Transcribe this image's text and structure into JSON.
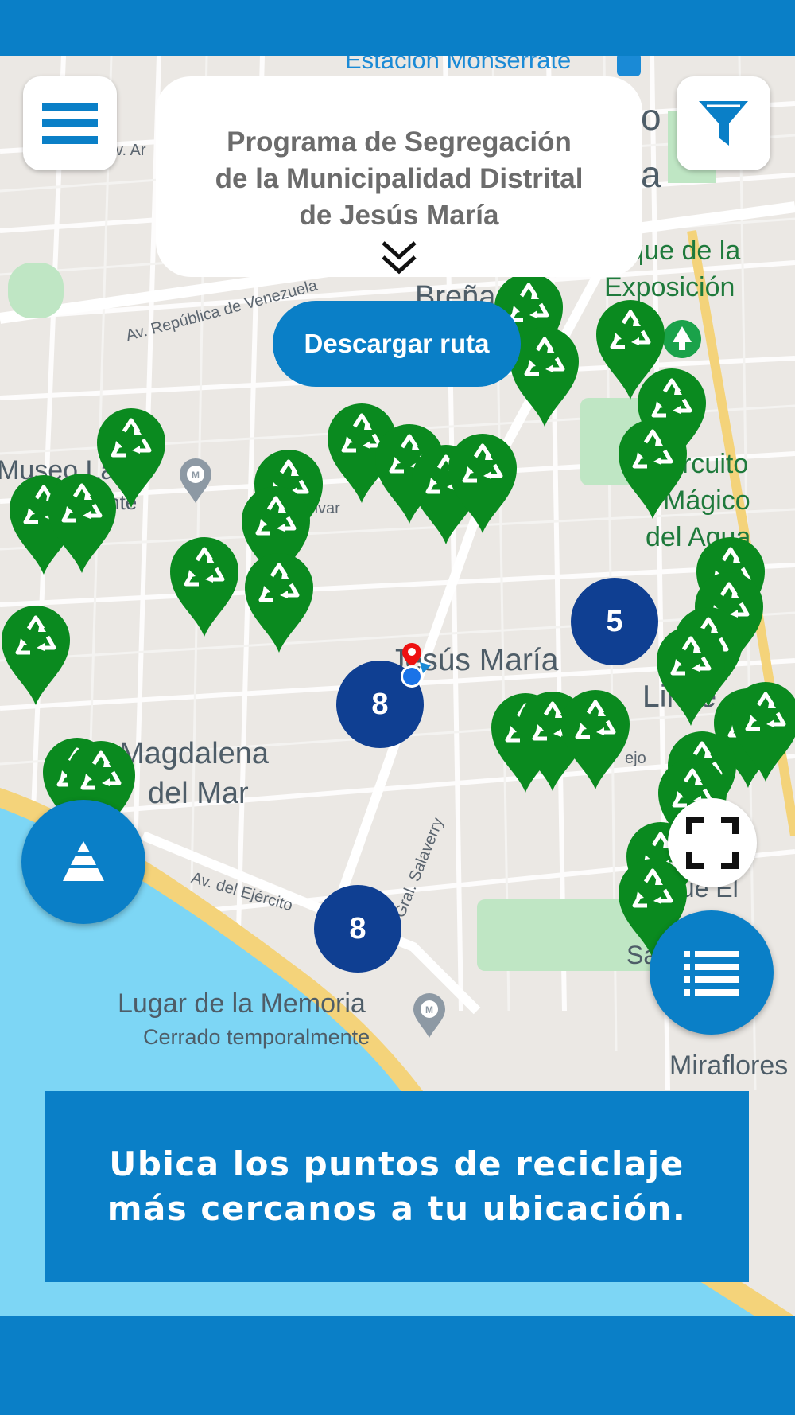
{
  "header": {
    "menu_icon": "hamburger-menu-icon",
    "filter_icon": "filter-funnel-icon"
  },
  "title_card": {
    "line1": "Programa de Segregación",
    "line2": "de la Municipalidad Distrital",
    "line3": "de Jesús María",
    "expand_icon": "double-chevron-down-icon"
  },
  "download_button": {
    "label": "Descargar ruta"
  },
  "map": {
    "labels": {
      "estacion": "Estación Monserrate",
      "brena": "Breña",
      "parque_expo_1": "rque de la",
      "parque_expo_2": "Exposición",
      "av_venezuela": "Av. República de Venezuela",
      "av_ar": "Av. Ar",
      "museo_1": "Museo La",
      "museo_2": "mente",
      "bolivar": "olivar",
      "circuito_1": "Circuito",
      "circuito_2": "Mágico",
      "circuito_3": "del Agua",
      "jesus_maria": "Jesús María",
      "lince": "Lince",
      "magdalena_1": "Magdalena",
      "magdalena_2": "del Mar",
      "av_ejercito": "Av. del Ejército",
      "salaverry": "Gral. Salaverry",
      "parque_el": "que El",
      "lugar_memoria": "Lugar de la Memoria",
      "cerrado": "Cerrado temporalmente",
      "miraflores": "Miraflores",
      "ejo": "ejo",
      "o": "o",
      "a": "a",
      "sa": "Sa"
    },
    "clusters": [
      {
        "label": "5"
      },
      {
        "label": "8"
      },
      {
        "label": "8"
      }
    ],
    "pin_icon": "recycling-pin-icon",
    "colors": {
      "pin": "#0a8a1f",
      "cluster": "#0f3f92",
      "water": "#7dd6f5",
      "park": "#bfe6c4"
    }
  },
  "controls": {
    "layers_icon": "layers-pyramid-icon",
    "fullscreen_icon": "fullscreen-icon",
    "list_icon": "list-icon"
  },
  "banner": {
    "line1": "Ubica los puntos de reciclaje",
    "line2": "más cercanos a tu ubicación."
  },
  "colors": {
    "brand": "#0a7fc7"
  }
}
